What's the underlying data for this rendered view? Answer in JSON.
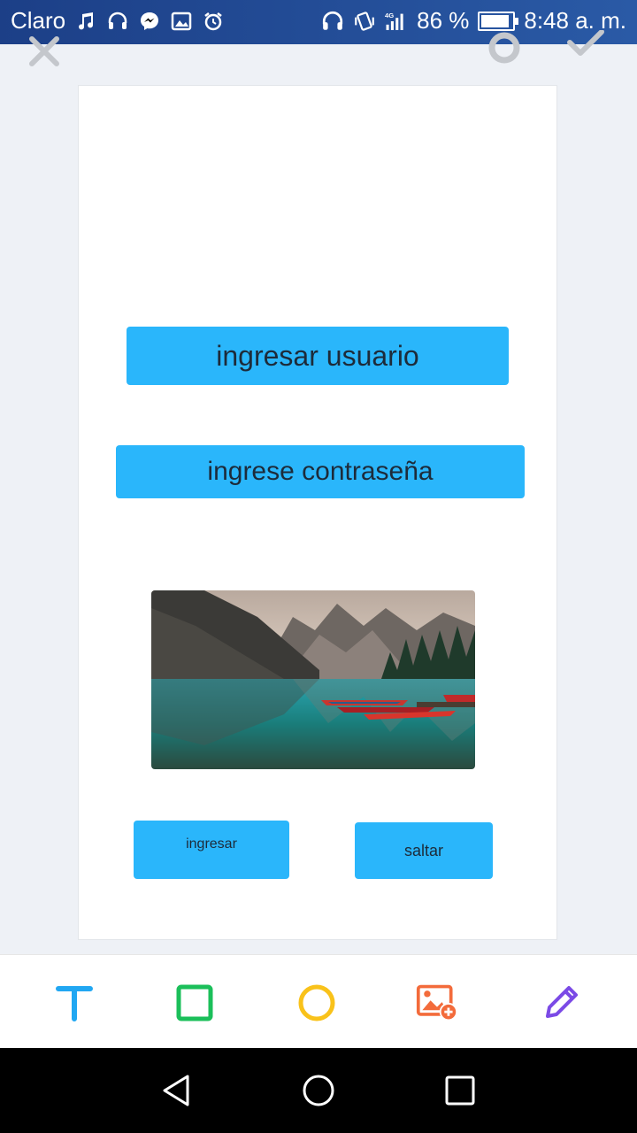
{
  "status_bar": {
    "carrier": "Claro",
    "icons": [
      "music-icon",
      "headset-icon",
      "messenger-icon",
      "gallery-icon",
      "alarm-icon"
    ],
    "battery_percent": "86 %",
    "time": "8:48 a. m.",
    "network": "4G"
  },
  "canvas": {
    "field_user": "ingresar usuario",
    "field_password": "ingrese contraseña",
    "button_ingresar": "ingresar",
    "button_saltar": "saltar",
    "accent_color": "#2ab6fb"
  },
  "tools": [
    "text-tool-icon",
    "rectangle-tool-icon",
    "circle-tool-icon",
    "add-image-tool-icon",
    "pen-tool-icon"
  ]
}
